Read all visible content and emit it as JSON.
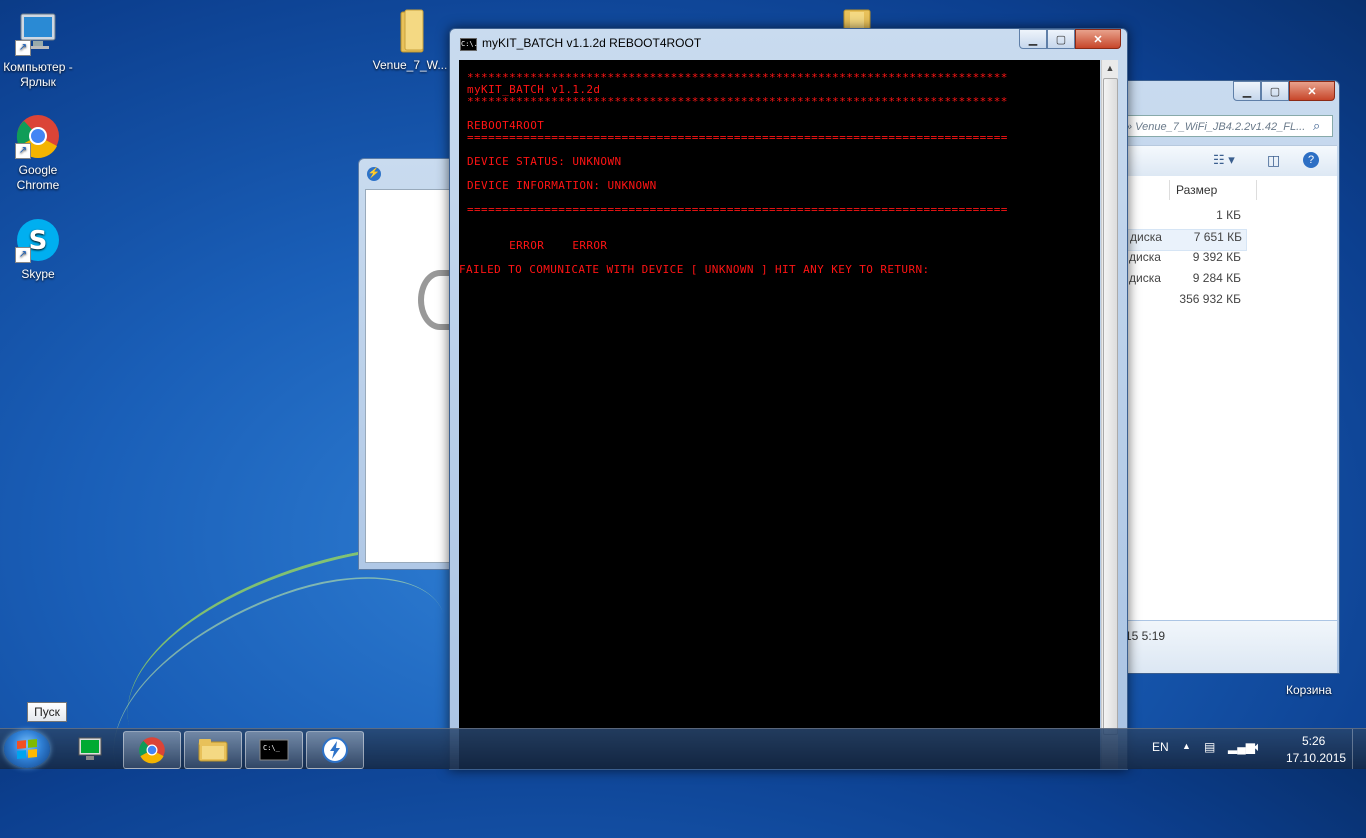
{
  "desktop": {
    "icons": [
      {
        "label": "Компьютер - Ярлык"
      },
      {
        "label": "Google Chrome"
      },
      {
        "label": "Skype"
      },
      {
        "label": "Venue_7_W..."
      }
    ],
    "recycle_bin": "Корзина"
  },
  "console": {
    "title": "myKIT_BATCH v1.1.2d REBOOT4ROOT",
    "icon_text": "C:\\.",
    "lines": {
      "stars1": "*****************************************************************************",
      "appname": "myKIT_BATCH v1.1.2d",
      "stars2": "*****************************************************************************",
      "mode": "REBOOT4ROOT",
      "sep1": "=============================================================================",
      "status": "DEVICE STATUS: UNKNOWN",
      "info": "DEVICE INFORMATION: UNKNOWN",
      "sep2": "=============================================================================",
      "error": "      ERROR    ERROR",
      "failed": "FAILED TO COMUNICATE WITH DEVICE [ UNKNOWN ] HIT ANY KEY TO RETURN:"
    },
    "colors": {
      "text": "#ff1414",
      "bg": "#000000"
    }
  },
  "explorer": {
    "address": "» Venue_7_WiFi_JB4.2.2v1.42_FL...",
    "column_size": "Размер",
    "rows": [
      {
        "type": "",
        "size": "1 КБ"
      },
      {
        "type": "диска",
        "size": "7 651 КБ"
      },
      {
        "type": "диска",
        "size": "9 392 КБ"
      },
      {
        "type": "диска",
        "size": "9 284 КБ"
      },
      {
        "type": "",
        "size": "356 932 КБ"
      }
    ],
    "details_time": "15 5:19"
  },
  "taskbar": {
    "tooltip": "Пуск",
    "lang": "EN",
    "time": "5:26",
    "date": "17.10.2015"
  }
}
